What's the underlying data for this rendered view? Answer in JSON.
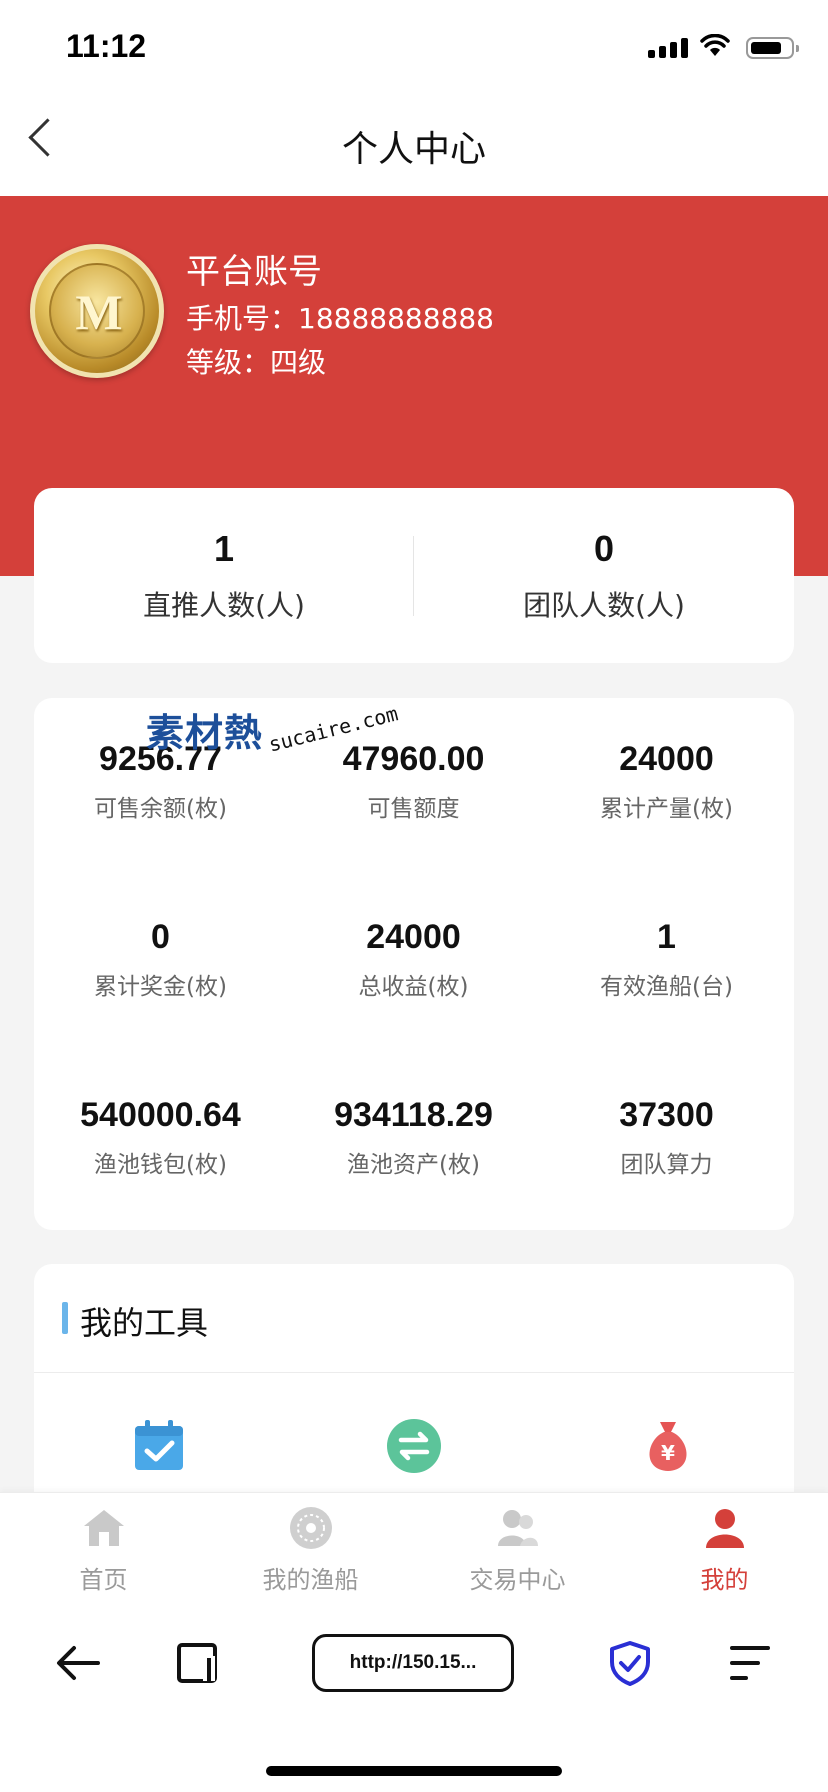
{
  "status": {
    "time": "11:12"
  },
  "header": {
    "title": "个人中心"
  },
  "profile": {
    "name": "平台账号",
    "phone": "手机号：18888888888",
    "level": "等级：四级"
  },
  "counts": [
    {
      "value": "1",
      "label": "直推人数(人)"
    },
    {
      "value": "0",
      "label": "团队人数(人)"
    }
  ],
  "stats": [
    {
      "value": "9256.77",
      "label": "可售余额(枚)"
    },
    {
      "value": "47960.00",
      "label": "可售额度"
    },
    {
      "value": "24000",
      "label": "累计产量(枚)"
    },
    {
      "value": "0",
      "label": "累计奖金(枚)"
    },
    {
      "value": "24000",
      "label": "总收益(枚)"
    },
    {
      "value": "1",
      "label": "有效渔船(台)"
    },
    {
      "value": "540000.64",
      "label": "渔池钱包(枚)"
    },
    {
      "value": "934118.29",
      "label": "渔池资产(枚)"
    },
    {
      "value": "37300",
      "label": "团队算力"
    }
  ],
  "watermark": {
    "cn": "素材熱",
    "en": "sucaire.com"
  },
  "tools": {
    "title": "我的工具",
    "icons": [
      "calendar-check-icon",
      "exchange-icon",
      "money-bag-icon"
    ]
  },
  "tabs": [
    {
      "label": "首页",
      "icon": "home-icon",
      "active": false
    },
    {
      "label": "我的渔船",
      "icon": "boat-icon",
      "active": false
    },
    {
      "label": "交易中心",
      "icon": "users-icon",
      "active": false
    },
    {
      "label": "我的",
      "icon": "user-icon",
      "active": true
    }
  ],
  "browser": {
    "url": "http://150.15..."
  },
  "colors": {
    "accent": "#d4403a",
    "tool_bar": "#6bb5ea",
    "inactive_tab": "#9a9a9a"
  }
}
